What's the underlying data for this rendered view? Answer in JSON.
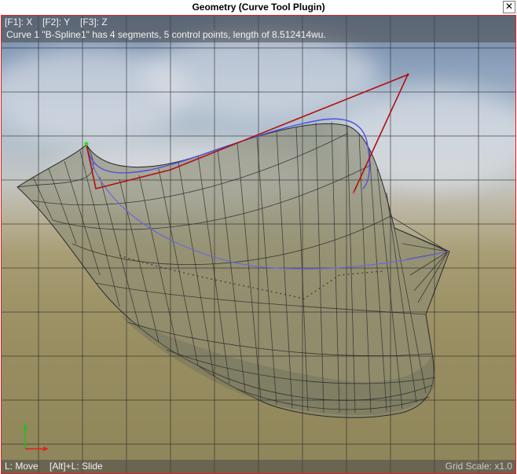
{
  "window": {
    "title": "Geometry (Curve Tool Plugin)",
    "close_glyph": "✕"
  },
  "toolbar": {
    "axis_hotkeys": [
      {
        "label": "[F1]: X"
      },
      {
        "label": "[F2]: Y"
      },
      {
        "label": "[F3]: Z"
      }
    ],
    "status": "Curve 1 \"B-Spline1\" has 4 segments, 5 control points, length of 8.512414wu."
  },
  "bottom_bar": {
    "hints": [
      {
        "label": "L: Move"
      },
      {
        "label": "[Alt]+L: Slide"
      }
    ],
    "grid_scale": "Grid Scale: x1.0"
  },
  "viewport": {
    "icons": [
      "axis-gizmo-icon",
      "close-icon"
    ],
    "colors": {
      "viewport_border": "#e02020",
      "control_polygon": "#b01010",
      "spline_curve": "#5050e0",
      "surface_fill": "#8a8a72",
      "mesh_lines": "#2a2a2a",
      "grid_lines": "#1e1e1e",
      "axis_y": "#20c020",
      "axis_x": "#e02020"
    }
  }
}
